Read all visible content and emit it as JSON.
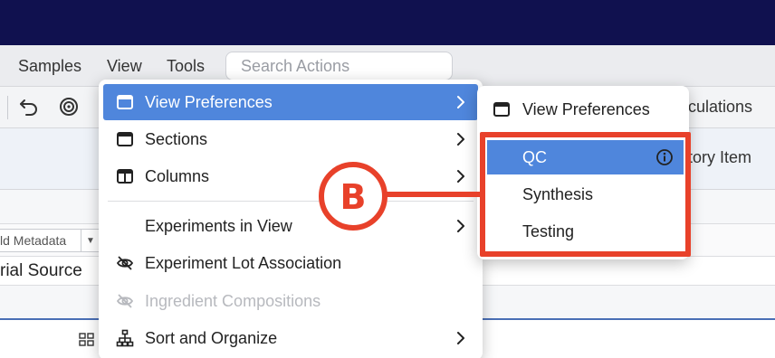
{
  "menubar": {
    "items": [
      "Samples",
      "View",
      "Tools"
    ],
    "search_placeholder": "Search Actions"
  },
  "background": {
    "tab_fragment": "culations",
    "inventory_fragment": "tory Item",
    "metadata_fragment": "ld Metadata",
    "source_fragment": "rial Source"
  },
  "dropdown": {
    "items": [
      {
        "label": "View Preferences",
        "icon": "window-icon",
        "submenu": true,
        "active": true
      },
      {
        "label": "Sections",
        "icon": "window-icon",
        "submenu": true
      },
      {
        "label": "Columns",
        "icon": "columns-icon",
        "submenu": true
      },
      {
        "label": "Experiments in View",
        "icon": "",
        "submenu": true
      },
      {
        "label": "Experiment Lot Association",
        "icon": "eye-off-icon",
        "submenu": false
      },
      {
        "label": "Ingredient Compositions",
        "icon": "eye-off-icon",
        "submenu": false,
        "disabled": true
      },
      {
        "label": "Sort and Organize",
        "icon": "hierarchy-icon",
        "submenu": true
      }
    ]
  },
  "submenu": {
    "header": "View Preferences",
    "items": [
      {
        "label": "QC",
        "active": true
      },
      {
        "label": "Synthesis"
      },
      {
        "label": "Testing"
      }
    ]
  },
  "annotation": {
    "letter": "B",
    "color": "#e8412a"
  },
  "colors": {
    "topbar": "#10114f",
    "accent": "#4f86dc"
  }
}
